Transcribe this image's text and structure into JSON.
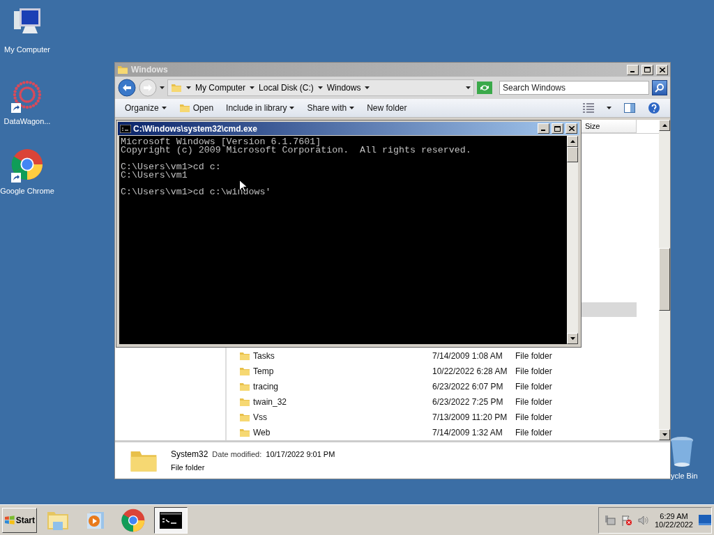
{
  "desktop_icons": [
    {
      "label": "My Computer",
      "kind": "computer",
      "shortcut": false
    },
    {
      "label": "DataWagon...",
      "kind": "datawagon",
      "shortcut": true
    },
    {
      "label": "Google Chrome",
      "kind": "chrome",
      "shortcut": true
    }
  ],
  "recycle_bin": {
    "label": "ycle Bin"
  },
  "explorer": {
    "title": "Windows",
    "breadcrumb": [
      "My Computer",
      "Local Disk (C:)",
      "Windows"
    ],
    "search": {
      "placeholder": "Search Windows"
    },
    "toolbar": [
      {
        "label": "Organize",
        "kind": "menu"
      },
      {
        "label": "Open",
        "kind": "open"
      },
      {
        "label": "Include in library",
        "kind": "menu"
      },
      {
        "label": "Share with",
        "kind": "menu"
      },
      {
        "label": "New folder",
        "kind": "plain"
      }
    ],
    "columns": [
      "Size"
    ],
    "rows": [
      {
        "name": "Tasks",
        "date": "7/14/2009 1:08 AM",
        "type": "File folder"
      },
      {
        "name": "Temp",
        "date": "10/22/2022 6:28 AM",
        "type": "File folder"
      },
      {
        "name": "tracing",
        "date": "6/23/2022 6:07 PM",
        "type": "File folder"
      },
      {
        "name": "twain_32",
        "date": "6/23/2022 7:25 PM",
        "type": "File folder"
      },
      {
        "name": "Vss",
        "date": "7/13/2009 11:20 PM",
        "type": "File folder"
      },
      {
        "name": "Web",
        "date": "7/14/2009 1:32 AM",
        "type": "File folder"
      }
    ],
    "details": {
      "name": "System32",
      "date_label": "Date modified:",
      "date": "10/17/2022 9:01 PM",
      "type": "File folder"
    }
  },
  "console": {
    "title": "C:\\Windows\\system32\\cmd.exe",
    "blocks": [
      [
        "Microsoft Windows [Version 6.1.7601]",
        "Copyright (c) 2009 Microsoft Corporation.  All rights reserved."
      ],
      [
        "C:\\Users\\vm1>cd c:",
        "C:\\Users\\vm1"
      ],
      [
        "C:\\Users\\vm1>cd c:\\windows'"
      ]
    ]
  },
  "taskbar": {
    "start": "Start",
    "items": [
      {
        "kind": "explorer",
        "selected": false
      },
      {
        "kind": "media",
        "selected": false
      },
      {
        "kind": "chrome",
        "selected": false
      },
      {
        "kind": "cmd",
        "selected": true
      }
    ],
    "time": "6:29 AM",
    "date": "10/22/2022"
  }
}
